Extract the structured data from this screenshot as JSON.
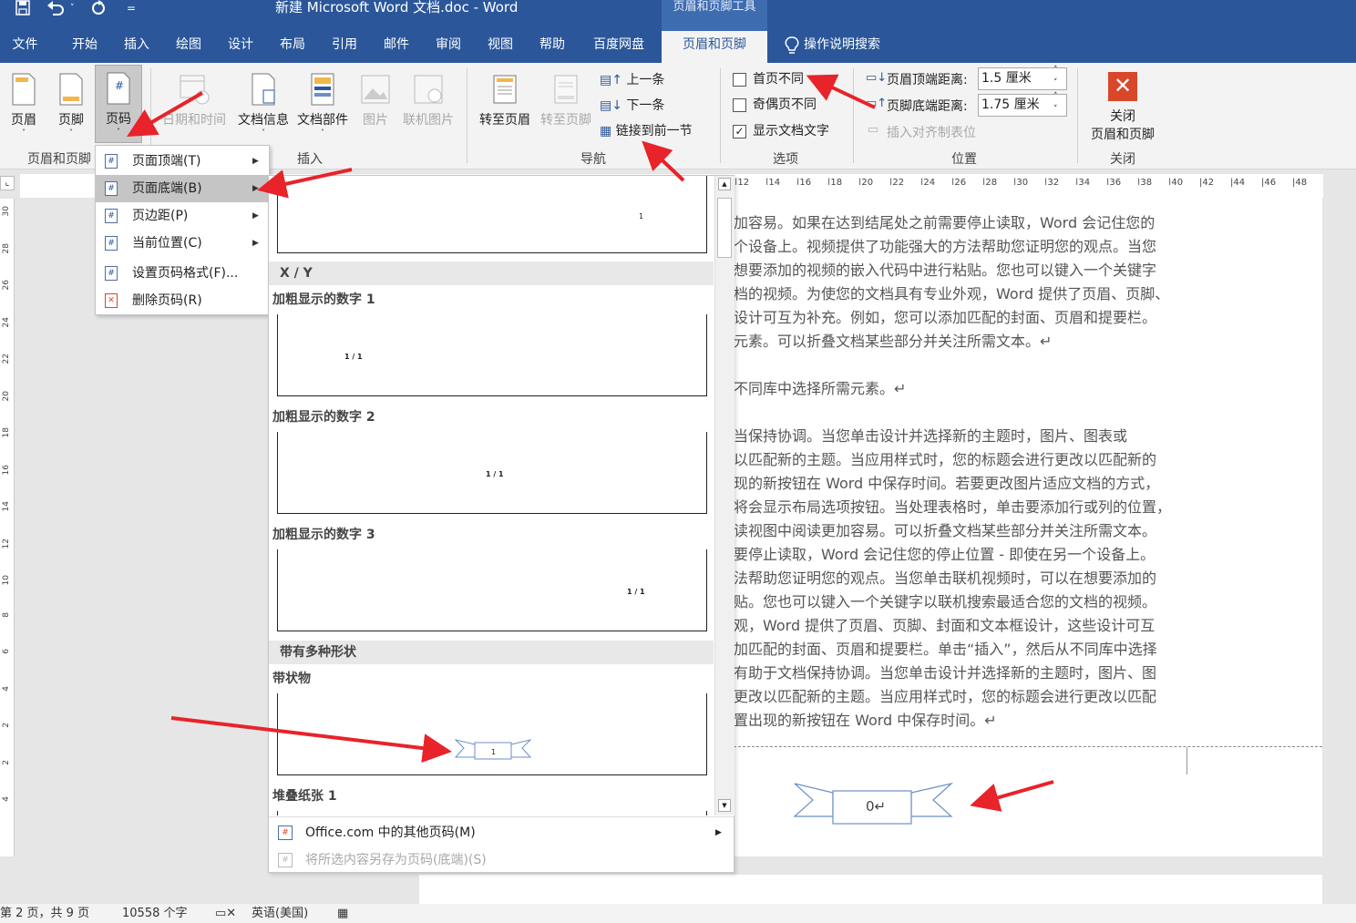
{
  "window": {
    "title": "新建 Microsoft Word 文档.doc  -  Word",
    "context_tab_title": "页眉和页脚工具"
  },
  "quick_access": {
    "save_icon": "save-icon",
    "undo_icon": "undo-icon",
    "redo_icon": "redo-icon",
    "more": "="
  },
  "tabs": [
    "文件",
    "开始",
    "插入",
    "绘图",
    "设计",
    "布局",
    "引用",
    "邮件",
    "审阅",
    "视图",
    "帮助",
    "百度网盘",
    "页眉和页脚",
    "操作说明搜索"
  ],
  "ribbon": {
    "header_footer_group": {
      "header": "页眉",
      "footer": "页脚",
      "page_number": "页码",
      "label": "页眉和页脚"
    },
    "insert_group": {
      "date_time": "日期和时间",
      "doc_info": "文档信息",
      "doc_parts": "文档部件",
      "picture": "图片",
      "online_picture": "联机图片",
      "label": "插入"
    },
    "nav_group": {
      "goto_header": "转至页眉",
      "goto_footer": "转至页脚",
      "prev": "上一条",
      "next": "下一条",
      "link_prev": "链接到前一节",
      "label": "导航"
    },
    "options_group": {
      "diff_first": "首页不同",
      "diff_odd_even": "奇偶页不同",
      "show_doc_text": "显示文档文字",
      "label": "选项",
      "diff_first_checked": false,
      "diff_odd_even_checked": false,
      "show_doc_text_checked": true
    },
    "position_group": {
      "header_top_label": "页眉顶端距离:",
      "header_top_value": "1.5 厘米",
      "footer_bottom_label": "页脚底端距离:",
      "footer_bottom_value": "1.75 厘米",
      "align_tab": "插入对齐制表位",
      "label": "位置"
    },
    "close_group": {
      "close_line1": "关闭",
      "close_line2": "页眉和页脚",
      "label": "关闭"
    }
  },
  "page_number_menu": {
    "items": [
      "页面顶端(T)",
      "页面底端(B)",
      "页边距(P)",
      "当前位置(C)",
      "设置页码格式(F)...",
      "删除页码(R)"
    ]
  },
  "gallery": {
    "first_thumb_num": "1",
    "sections": [
      {
        "header": "X / Y",
        "items": [
          {
            "caption": "加粗显示的数字 1",
            "sample": "1 / 1"
          },
          {
            "caption": "加粗显示的数字 2",
            "sample": "1 / 1"
          },
          {
            "caption": "加粗显示的数字 3",
            "sample": "1 / 1"
          }
        ]
      },
      {
        "header": "带有多种形状",
        "items": [
          {
            "caption": "带状物",
            "sample": "1"
          },
          {
            "caption": "堆叠纸张 1",
            "sample": ""
          }
        ]
      }
    ],
    "footer_more": "Office.com 中的其他页码(M)",
    "footer_save": "将所选内容另存为页码(底端)(S)"
  },
  "ruler": {
    "h_ticks": [
      "12",
      "14",
      "16",
      "18",
      "20",
      "22",
      "24",
      "26",
      "28",
      "30",
      "32",
      "34",
      "36",
      "38",
      "40",
      "42",
      "44",
      "46",
      "48"
    ],
    "v_ticks": [
      "30",
      "28",
      "26",
      "24",
      "22",
      "20",
      "18",
      "16",
      "14",
      "12",
      "10",
      "8",
      "6",
      "4",
      "2",
      "2",
      "4"
    ]
  },
  "document": {
    "lines": [
      "加容易。如果在达到结尾处之前需要停止读取，Word 会记住您的",
      "个设备上。视频提供了功能强大的方法帮助您证明您的观点。当您",
      "想要添加的视频的嵌入代码中进行粘贴。您也可以键入一个关键字",
      "档的视频。为使您的文档具有专业外观，Word 提供了页眉、页脚、",
      "设计可互为补充。例如，您可以添加匹配的封面、页眉和提要栏。",
      "元素。可以折叠文档某些部分并关注所需文本。↵",
      "不同库中选择所需元素。↵",
      "当保持协调。当您单击设计并选择新的主题时，图片、图表或",
      "以匹配新的主题。当应用样式时，您的标题会进行更改以匹配新的",
      "现的新按钮在 Word 中保存时间。若要更改图片适应文档的方式，",
      "将会显示布局选项按钮。当处理表格时，单击要添加行或列的位置，",
      "读视图中阅读更加容易。可以折叠文档某些部分并关注所需文本。",
      "要停止读取，Word 会记住您的停止位置 - 即使在另一个设备上。",
      "法帮助您证明您的观点。当您单击联机视频时，可以在想要添加的",
      "贴。您也可以键入一个关键字以联机搜索最适合您的文档的视频。",
      "观，Word 提供了页眉、页脚、封面和文本框设计，这些设计可互",
      "加匹配的封面、页眉和提要栏。单击“插入”，然后从不同库中选择",
      "有助于文档保持协调。当您单击设计并选择新的主题时，图片、图",
      "更改以匹配新的主题。当应用样式时，您的标题会进行更改以匹配",
      "置出现的新按钮在 Word 中保存时间。↵"
    ],
    "footer_page_number": "0↵"
  },
  "status": {
    "page": "第 2 页，共 9 页",
    "words": "10558 个字",
    "language": "英语(美国)"
  },
  "colors": {
    "brand": "#2b579a",
    "annotation_arrow": "#e8232a",
    "close_button": "#d9472b"
  }
}
